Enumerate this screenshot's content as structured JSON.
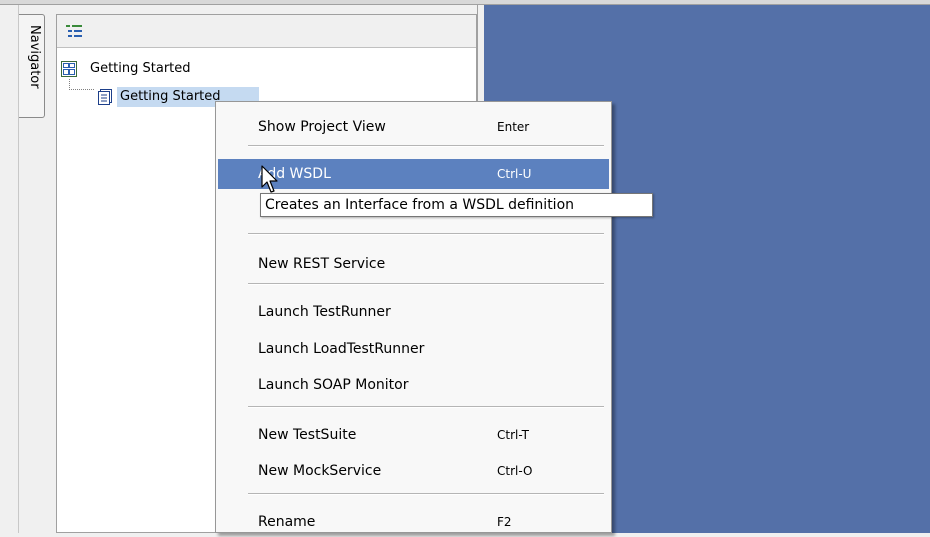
{
  "navigator": {
    "tab_label": "Navigator",
    "toolbar_icon": "tree-view-icon",
    "tree": [
      {
        "label": "Getting Started",
        "icon": "workspace-icon",
        "selected": false
      },
      {
        "label": "Getting Started",
        "icon": "project-icon",
        "selected": true
      }
    ]
  },
  "context_menu": {
    "items": [
      {
        "label": "Show Project View",
        "shortcut": "Enter"
      },
      {
        "label": "Add WSDL",
        "shortcut": "Ctrl-U",
        "highlighted": true
      },
      {
        "label": "New REST Service",
        "shortcut": ""
      },
      {
        "label": "Launch TestRunner",
        "shortcut": ""
      },
      {
        "label": "Launch LoadTestRunner",
        "shortcut": ""
      },
      {
        "label": "Launch SOAP Monitor",
        "shortcut": ""
      },
      {
        "label": "New TestSuite",
        "shortcut": "Ctrl-T"
      },
      {
        "label": "New MockService",
        "shortcut": "Ctrl-O"
      },
      {
        "label": "Rename",
        "shortcut": "F2"
      }
    ]
  },
  "tooltip": {
    "text": "Creates an Interface from a WSDL definition"
  },
  "colors": {
    "desktop": "#5470a8",
    "menu_highlight": "#5c81bf",
    "tree_selection": "#c5daf1"
  }
}
